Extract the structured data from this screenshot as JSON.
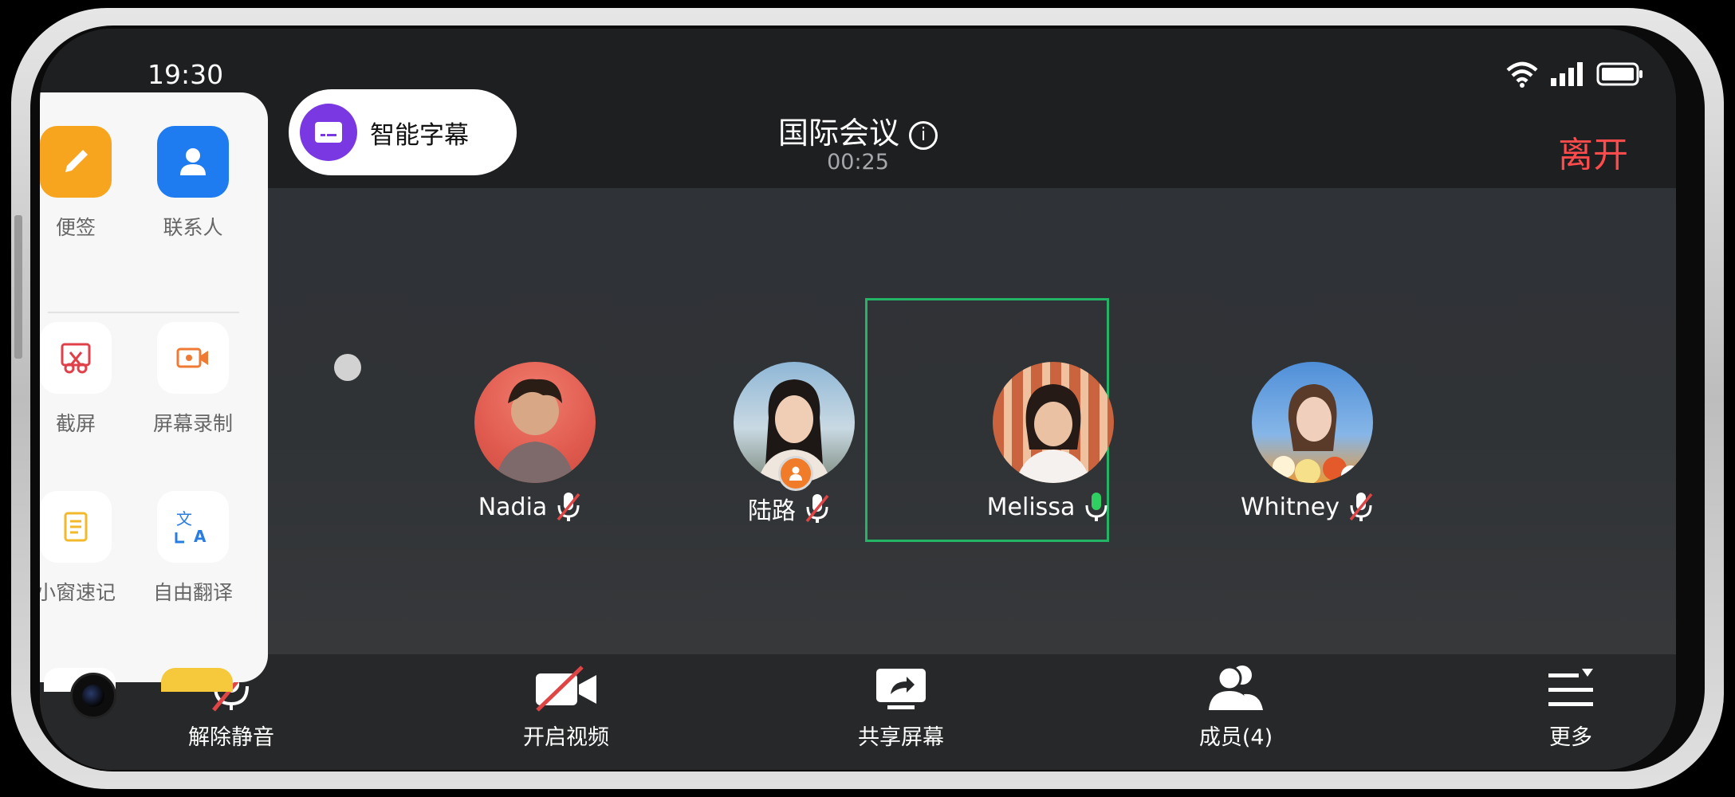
{
  "status_bar": {
    "time": "19:30"
  },
  "caption_button": {
    "label": "智能字幕"
  },
  "meeting": {
    "title": "国际会议",
    "timer": "00:25",
    "leave_label": "离开"
  },
  "participants": [
    {
      "name": "Nadia",
      "mic": "muted"
    },
    {
      "name": "陆路",
      "mic": "muted",
      "is_host": true
    },
    {
      "name": "Melissa",
      "mic": "active",
      "speaking": true
    },
    {
      "name": "Whitney",
      "mic": "muted"
    }
  ],
  "side_panel": {
    "apps": [
      {
        "label": "便签",
        "icon": "note-icon",
        "color": "#f7a51e"
      },
      {
        "label": "联系人",
        "icon": "contact-icon",
        "color": "#1e7cf0"
      },
      {
        "label": "截屏",
        "icon": "screenshot-icon",
        "color": "#e0404a"
      },
      {
        "label": "屏幕录制",
        "icon": "screen-record-icon",
        "color": "#ef7a33"
      },
      {
        "label": "小窗速记",
        "icon": "quick-note-icon",
        "color": "#f2b92b"
      },
      {
        "label": "自由翻译",
        "icon": "translate-icon",
        "color": "#2a7de0"
      }
    ]
  },
  "toolbar": {
    "unmute_label": "解除静音",
    "video_label": "开启视频",
    "share_label": "共享屏幕",
    "members_label": "成员(4)",
    "more_label": "更多"
  },
  "colors": {
    "accent_active": "#23b565",
    "leave": "#ff4b4b",
    "caption": "#7a38e3",
    "muted": "#e04545"
  }
}
